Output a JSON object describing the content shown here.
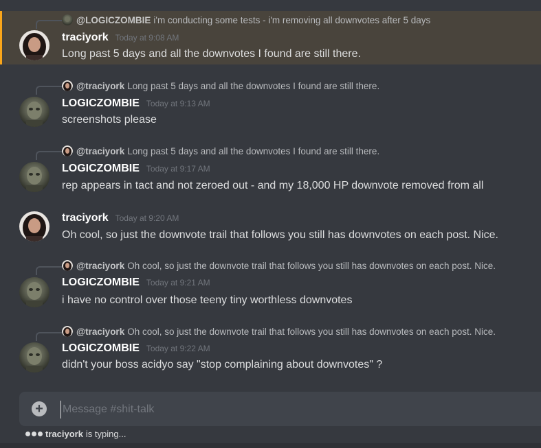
{
  "channel": {
    "placeholder": "Message #shit-talk"
  },
  "typing": {
    "user": "traciyork",
    "suffix": "is typing..."
  },
  "messages": [
    {
      "reply": {
        "name": "@LOGICZOMBIE",
        "text": "i'm conducting some tests - i'm removing all downvotes after 5 days"
      },
      "author": "traciyork",
      "time": "Today at 9:08 AM",
      "text": "Long past 5 days and all the downvotes I found are still there."
    },
    {
      "reply": {
        "name": "@traciyork",
        "text": "Long past 5 days and all the downvotes I found are still there."
      },
      "author": "LOGICZOMBIE",
      "time": "Today at 9:13 AM",
      "text": "screenshots please"
    },
    {
      "reply": {
        "name": "@traciyork",
        "text": "Long past 5 days and all the downvotes I found are still there."
      },
      "author": "LOGICZOMBIE",
      "time": "Today at 9:17 AM",
      "text": "rep appears in tact and not zeroed out - and my 18,000 HP downvote removed from all"
    },
    {
      "author": "traciyork",
      "time": "Today at 9:20 AM",
      "text": "Oh cool, so just the downvote trail that follows you still has downvotes on each post. Nice."
    },
    {
      "reply": {
        "name": "@traciyork",
        "text": "Oh cool, so just the downvote trail that follows you still has downvotes on each post. Nice."
      },
      "author": "LOGICZOMBIE",
      "time": "Today at 9:21 AM",
      "text": "i have no control over those teeny tiny worthless downvotes"
    },
    {
      "reply": {
        "name": "@traciyork",
        "text": "Oh cool, so just the downvote trail that follows you still has downvotes on each post. Nice."
      },
      "author": "LOGICZOMBIE",
      "time": "Today at 9:22 AM",
      "text": "didn't your boss acidyo say \"stop complaining about downvotes\" ?"
    }
  ]
}
